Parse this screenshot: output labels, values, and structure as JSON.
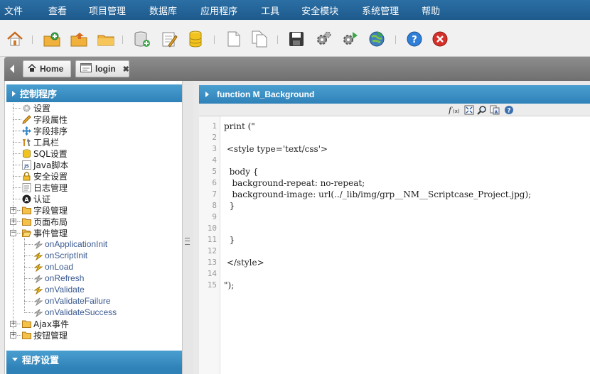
{
  "menu": [
    "文件",
    "查看",
    "项目管理",
    "数据库",
    "应用程序",
    "工具",
    "安全模块",
    "系统管理",
    "帮助"
  ],
  "toolbar_icons": [
    "home-icon",
    "new-project-icon",
    "open-project-icon",
    "folder-icon",
    "new-connection-icon",
    "edit-connection-icon",
    "database-icon",
    "new-document-icon",
    "copy-document-icon",
    "save-icon",
    "settings-icon",
    "run-settings-icon",
    "publish-icon",
    "help-icon",
    "close-icon"
  ],
  "tabs": [
    {
      "label": "Home"
    },
    {
      "label": "login",
      "close": "✖"
    }
  ],
  "left_panel": {
    "title": "控制程序",
    "items": [
      "设置",
      "字段属性",
      "字段排序",
      "工具栏",
      "SQL设置",
      "Java脚本",
      "安全设置",
      "日志管理",
      "认证"
    ],
    "folders": [
      {
        "label": "字段管理",
        "expander": "+"
      },
      {
        "label": "页面布局",
        "expander": "+"
      },
      {
        "label": "事件管理",
        "expander": "−"
      }
    ],
    "events": [
      "onApplicationInit",
      "onScriptInit",
      "onLoad",
      "onRefresh",
      "onValidate",
      "onValidateFailure",
      "onValidateSuccess"
    ],
    "folders_after": [
      {
        "label": "Ajax事件",
        "expander": "+"
      },
      {
        "label": "按钮管理",
        "expander": "+"
      }
    ],
    "bottom_title": "程序设置"
  },
  "editor": {
    "title": "function M_Background",
    "tool_icons": [
      "function-icon",
      "fullscreen-icon",
      "search-icon",
      "replace-icon",
      "help-icon"
    ],
    "lines": [
      "print (\"",
      "",
      " <style type='text/css'>",
      "",
      "  body {",
      "   background-repeat: no-repeat;",
      "   background-image: url(../_lib/img/grp__NM__Scriptcase_Project.jpg);",
      "  }",
      "",
      "",
      "  }",
      "",
      " </style>",
      "",
      "\");"
    ],
    "line_numbers": [
      "1",
      "2",
      "3",
      "4",
      "5",
      "6",
      "7",
      "8",
      "9",
      "10",
      "11",
      "12",
      "13",
      "14",
      "15"
    ]
  },
  "colors": {
    "menubar": "#1e5a8c",
    "panel_header": "#2f82b8",
    "tab_strip": "#7a7a7a"
  }
}
